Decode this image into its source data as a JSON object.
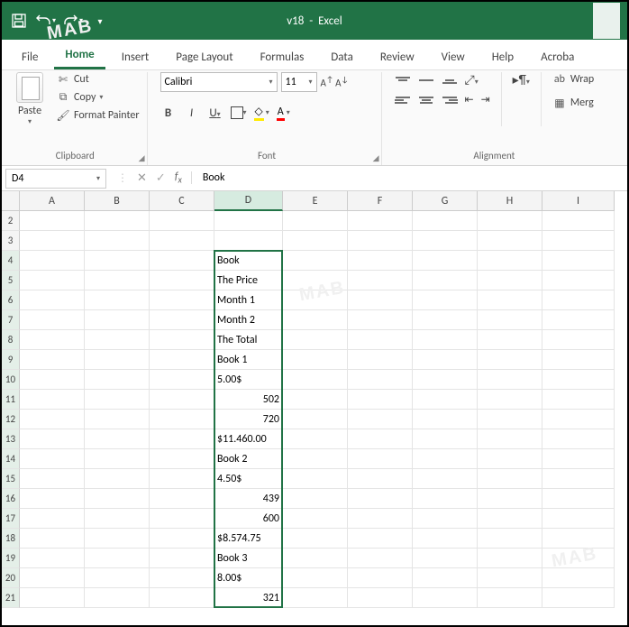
{
  "titlebar": {
    "filename": "v18",
    "appname": "Excel"
  },
  "qat": {
    "save": "save-icon",
    "undo": "undo-icon",
    "redo": "redo-icon"
  },
  "tabs": {
    "file": "File",
    "home": "Home",
    "insert": "Insert",
    "page_layout": "Page Layout",
    "formulas": "Formulas",
    "data": "Data",
    "review": "Review",
    "view": "View",
    "help": "Help",
    "acrobat": "Acroba"
  },
  "ribbon": {
    "clipboard": {
      "label": "Clipboard",
      "paste": "Paste",
      "cut": "Cut",
      "copy": "Copy",
      "format_painter": "Format Painter"
    },
    "font": {
      "label": "Font",
      "name": "Calibri",
      "size": "11"
    },
    "alignment": {
      "label": "Alignment",
      "wrap": "Wrap",
      "merge": "Merg"
    }
  },
  "namebox": {
    "ref": "D4"
  },
  "formulabar": {
    "value": "Book"
  },
  "columns": [
    "A",
    "B",
    "C",
    "D",
    "E",
    "F",
    "G",
    "H",
    "I"
  ],
  "rows": [
    2,
    3,
    4,
    5,
    6,
    7,
    8,
    9,
    10,
    11,
    12,
    13,
    14,
    15,
    16,
    17,
    18,
    19,
    20,
    21
  ],
  "cells": {
    "D4": "Book",
    "D5": "The Price",
    "D6": "Month 1",
    "D7": "Month 2",
    "D8": "The Total",
    "D9": "Book 1",
    "D10": "5.00$",
    "D11": "502",
    "D12": "720",
    "D13": "$11.460.00",
    "D14": "Book 2",
    "D15": "4.50$",
    "D16": "439",
    "D17": "600",
    "D18": "$8.574.75",
    "D19": "Book 3",
    "D20": "8.00$",
    "D21": "321"
  },
  "numeric_cells": [
    "D11",
    "D12",
    "D16",
    "D17",
    "D21"
  ],
  "selection": {
    "active": "D4",
    "range_start_row": 4,
    "range_end_row": 21,
    "col": "D"
  }
}
